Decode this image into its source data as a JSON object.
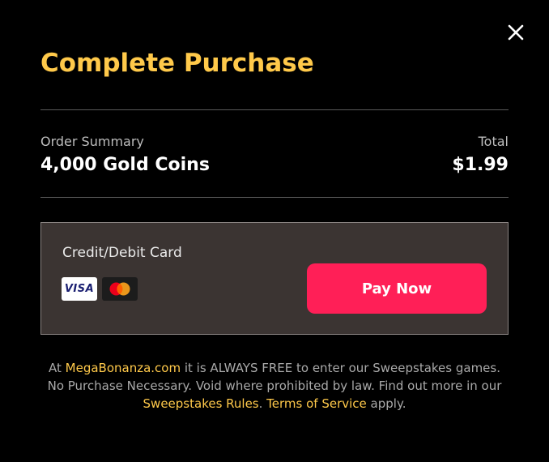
{
  "dialog": {
    "title": "Complete Purchase",
    "close_icon": "close-icon"
  },
  "order": {
    "summary_label": "Order Summary",
    "item": "4,000 Gold Coins",
    "total_label": "Total",
    "total_value": "$1.99"
  },
  "payment": {
    "method_label": "Credit/Debit Card",
    "cards": [
      {
        "name": "VISA",
        "icon": "visa-card-icon"
      },
      {
        "name": "Mastercard",
        "icon": "mastercard-icon"
      }
    ],
    "pay_button_label": "Pay Now"
  },
  "disclaimer": {
    "part1": "At ",
    "site_link": "MegaBonanza.com",
    "part2": " it is ALWAYS FREE to enter our Sweepstakes games. No Purchase Necessary. Void where prohibited by law. Find out more in our ",
    "rules_link": "Sweepstakes Rules",
    "part3": ". ",
    "terms_link": "Terms of Service",
    "part4": " apply."
  },
  "colors": {
    "background": "#000000",
    "title": "#ffc94a",
    "link": "#ffc94a",
    "pay_button": "#ff1f57",
    "payment_box": "#3b3432"
  }
}
